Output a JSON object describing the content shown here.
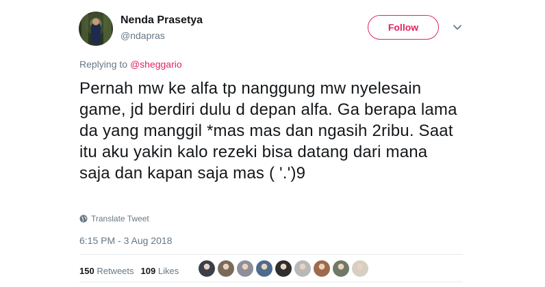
{
  "author": {
    "name": "Nenda Prasetya",
    "handle": "@ndapras"
  },
  "follow_button": {
    "label": "Follow",
    "color": "#e0245e"
  },
  "reply": {
    "prefix": "Replying to",
    "mention": "@sheggario"
  },
  "tweet": {
    "text": "Pernah mw ke alfa tp nanggung mw nyelesain game, jd berdiri dulu d depan alfa. Ga berapa lama da yang manggil *mas mas dan ngasih 2ribu. Saat itu aku yakin kalo rezeki bisa datang dari mana saja dan kapan saja mas ( '.')9"
  },
  "translate_label": "Translate Tweet",
  "timestamp": "6:15 PM - 3 Aug 2018",
  "stats": {
    "retweets_count": "150",
    "retweets_label": "Retweets",
    "likes_count": "109",
    "likes_label": "Likes"
  },
  "likers": [
    {
      "color": "#3b3f4a"
    },
    {
      "color": "#7a6a5c"
    },
    {
      "color": "#8d8f9a"
    },
    {
      "color": "#4d6c8c"
    },
    {
      "color": "#2e2e2e"
    },
    {
      "color": "#b8b8b8"
    },
    {
      "color": "#9e6b4a"
    },
    {
      "color": "#6f7a66"
    },
    {
      "color": "#d8cfc4"
    }
  ]
}
